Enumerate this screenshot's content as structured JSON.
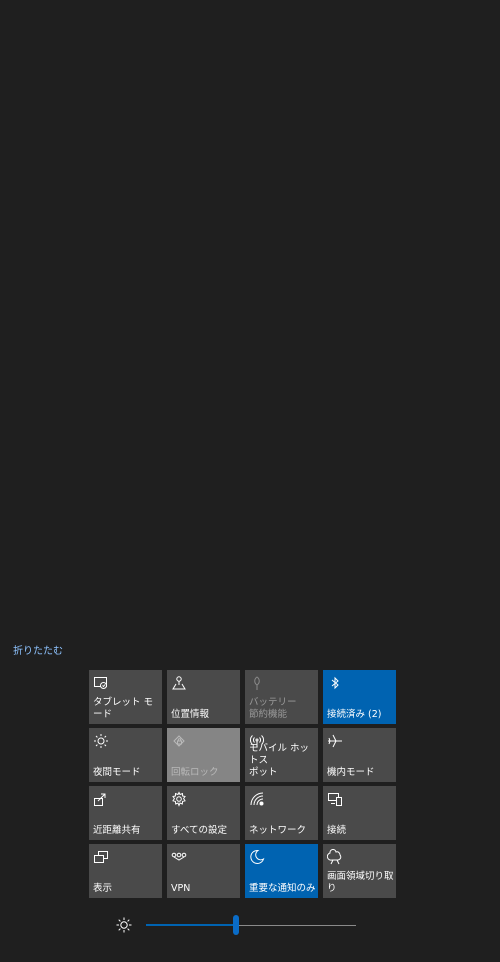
{
  "collapse_label": "折りたたむ",
  "tiles": [
    {
      "label": "タブレット モード",
      "icon": "tablet-mode-icon"
    },
    {
      "label": "位置情報",
      "icon": "location-icon"
    },
    {
      "label": "バッテリー\n節約機能",
      "icon": "battery-saver-icon"
    },
    {
      "label": "接続済み (2)",
      "icon": "bluetooth-icon"
    },
    {
      "label": "夜間モード",
      "icon": "night-light-icon"
    },
    {
      "label": "回転ロック",
      "icon": "rotation-lock-icon"
    },
    {
      "label": "モバイル ホットス\nポット",
      "icon": "mobile-hotspot-icon"
    },
    {
      "label": "機内モード",
      "icon": "airplane-mode-icon"
    },
    {
      "label": "近距離共有",
      "icon": "nearby-sharing-icon"
    },
    {
      "label": "すべての設定",
      "icon": "settings-gear-icon"
    },
    {
      "label": "ネットワーク",
      "icon": "network-icon"
    },
    {
      "label": "接続",
      "icon": "connect-icon"
    },
    {
      "label": "表示",
      "icon": "project-display-icon"
    },
    {
      "label": "VPN",
      "icon": "vpn-icon"
    },
    {
      "label": "重要な通知のみ",
      "icon": "focus-assist-moon-icon"
    },
    {
      "label": "画面領域切り取\nり",
      "icon": "screen-snip-icon"
    }
  ],
  "brightness": {
    "icon": "brightness-sun-icon",
    "value": 0.43
  },
  "colors": {
    "background": "#1f1f1f",
    "tile": "#4a4a4a",
    "tile_active": "#0063b1",
    "tile_disabled_light": "#858585",
    "link": "#8ec3ff"
  }
}
